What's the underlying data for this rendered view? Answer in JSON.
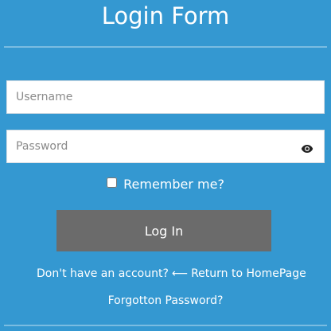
{
  "form": {
    "title": "Login Form",
    "username_placeholder": "Username",
    "password_placeholder": "Password",
    "remember_label": "Remember me?",
    "remember_checked": false,
    "login_label": "Log In",
    "signup_link": "Don't have an account?",
    "home_arrow": "⟵",
    "home_link": "Return to HomePage",
    "forgot_link": "Forgotton Password?"
  },
  "icons": {
    "password_toggle": "eye-icon"
  },
  "colors": {
    "background": "#3498d1",
    "button": "#6b6b6b",
    "text": "#ffffff"
  }
}
